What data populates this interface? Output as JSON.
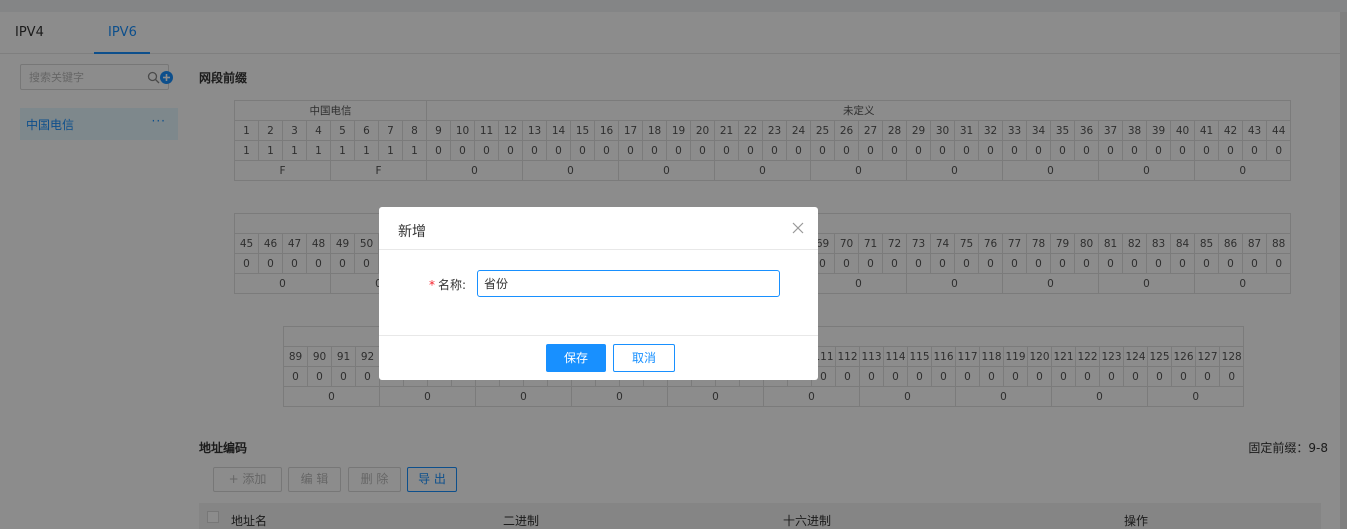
{
  "tabs": [
    "IPV4",
    "IPV6"
  ],
  "sidebar": {
    "search_placeholder": "搜索关键字",
    "items": [
      {
        "label": "中国电信",
        "more": "···"
      }
    ]
  },
  "prefix_section": {
    "title": "网段前缀",
    "blocks": [
      {
        "groups": [
          {
            "label": "中国电信",
            "span": 8
          },
          {
            "label": "未定义",
            "span": 36
          }
        ],
        "start": 1,
        "end": 44,
        "bits": "11111111000000000000000000000000000000000000",
        "hex": [
          "F",
          "F",
          "0",
          "0",
          "0",
          "0",
          "0",
          "0",
          "0",
          "0",
          "0"
        ]
      },
      {
        "groups": [
          {
            "label": "",
            "span": 44
          }
        ],
        "start": 45,
        "end": 88,
        "bits": "00000000000000000000000000000000000000000000",
        "hex": [
          "0",
          "0",
          "0",
          "0",
          "0",
          "0",
          "0",
          "0",
          "0",
          "0",
          "0"
        ]
      },
      {
        "groups": [
          {
            "label": "",
            "span": 40
          }
        ],
        "start": 89,
        "end": 128,
        "bits": "0000000000000000000000000000000000000000",
        "hex": [
          "0",
          "0",
          "0",
          "0",
          "0",
          "0",
          "0",
          "0",
          "0",
          "0"
        ]
      }
    ]
  },
  "address_section": {
    "title": "地址编码",
    "fixed_prefix": "固定前缀：9-8",
    "toolbar": {
      "add": "+ 添加",
      "edit": "编 辑",
      "delete": "删 除",
      "export": "导 出"
    },
    "columns": [
      "地址名",
      "二进制",
      "十六进制",
      "操作"
    ]
  },
  "modal": {
    "title": "新增",
    "field_label": "名称:",
    "required_mark": "*",
    "field_value": "省份",
    "save": "保存",
    "cancel": "取消"
  },
  "colors": {
    "accent": "#1890ff",
    "required": "#f5222d"
  },
  "icons": {
    "search": "search-icon",
    "add": "plus-circle-icon",
    "close": "close-icon",
    "checkbox": "checkbox-icon"
  }
}
